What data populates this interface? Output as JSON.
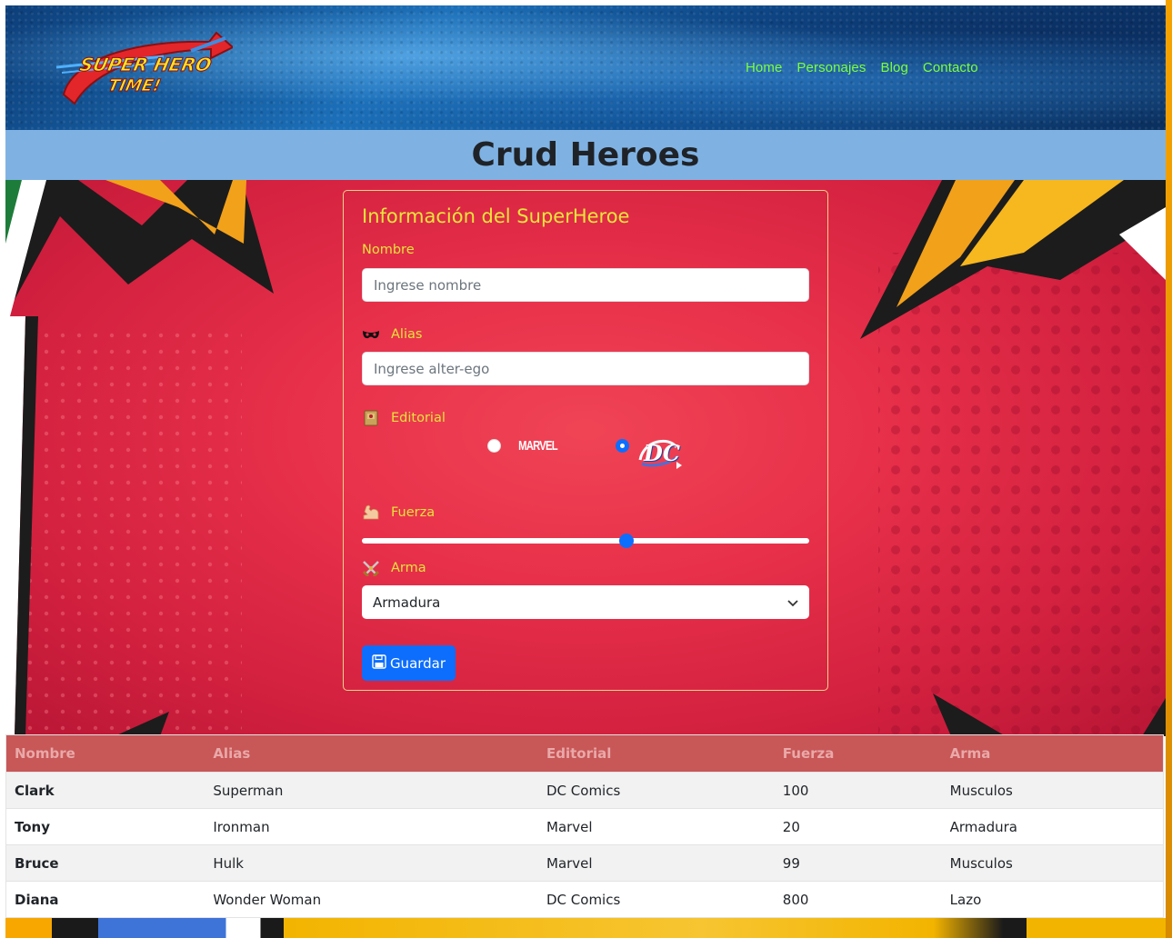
{
  "header": {
    "logo": {
      "line1": "SUPER HERO",
      "line2": "TIME!"
    },
    "nav": [
      {
        "label": "Home"
      },
      {
        "label": "Personajes"
      },
      {
        "label": "Blog"
      },
      {
        "label": "Contacto"
      }
    ]
  },
  "page_title": "Crud Heroes",
  "form": {
    "title": "Información del SuperHeroe",
    "nombre": {
      "label": "Nombre",
      "placeholder": "Ingrese nombre",
      "value": ""
    },
    "alias": {
      "label": "Alias",
      "icon": "mask-icon",
      "placeholder": "Ingrese alter-ego",
      "value": ""
    },
    "editorial": {
      "label": "Editorial",
      "icon": "book-icon",
      "options": [
        {
          "logo_text": "MARVEL",
          "checked": false
        },
        {
          "logo_text": "DC",
          "checked": true
        }
      ]
    },
    "fuerza": {
      "label": "Fuerza",
      "icon": "flexed-biceps-icon",
      "value_fraction": 0.595
    },
    "arma": {
      "label": "Arma",
      "icon": "crossed-swords-icon",
      "selected": "Armadura"
    },
    "save_label": "Guardar"
  },
  "table": {
    "headers": [
      "Nombre",
      "Alias",
      "Editorial",
      "Fuerza",
      "Arma"
    ],
    "rows": [
      [
        "Clark",
        "Superman",
        "DC Comics",
        "100",
        "Musculos"
      ],
      [
        "Tony",
        "Ironman",
        "Marvel",
        "20",
        "Armadura"
      ],
      [
        "Bruce",
        "Hulk",
        "Marvel",
        "99",
        "Musculos"
      ],
      [
        "Diana",
        "Wonder Woman",
        "DC Comics",
        "800",
        "Lazo"
      ]
    ]
  },
  "colors": {
    "nav_link": "#7CFF3A",
    "title_bar": "#7fb2e3",
    "label": "#e5e43a",
    "primary": "#0d6efd",
    "table_header": "#c85758"
  }
}
